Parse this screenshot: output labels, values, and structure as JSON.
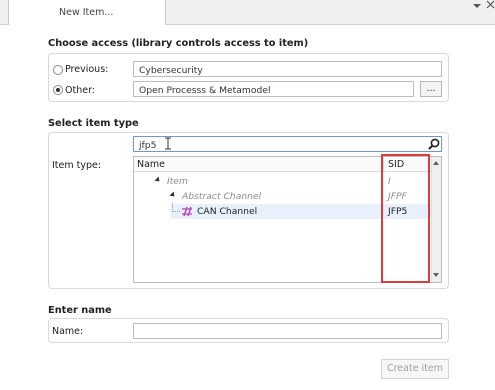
{
  "tab": {
    "label": "New Item..."
  },
  "access": {
    "title": "Choose access (library controls access to item)",
    "previous_label": "Previous:",
    "previous_value": "Cybersecurity",
    "other_label": "Other:",
    "other_value": "Open Processs & Metamodel",
    "browse_label": "...",
    "selected": "other"
  },
  "item_type": {
    "title": "Select item type",
    "search_value": "jfp5",
    "field_label": "Item type:",
    "columns": {
      "name": "Name",
      "sid": "SID"
    },
    "rows": [
      {
        "name": "Item",
        "sid": "I"
      },
      {
        "name": "Abstract Channel",
        "sid": "JFPF"
      },
      {
        "name": "CAN Channel",
        "sid": "JFP5"
      }
    ]
  },
  "name_section": {
    "title": "Enter name",
    "label": "Name:",
    "value": ""
  },
  "create_button": "Create item",
  "colors": {
    "selection": "#e8f1fb",
    "highlight_border": "#e03a3a",
    "icon_magenta": "#b83ec4"
  }
}
